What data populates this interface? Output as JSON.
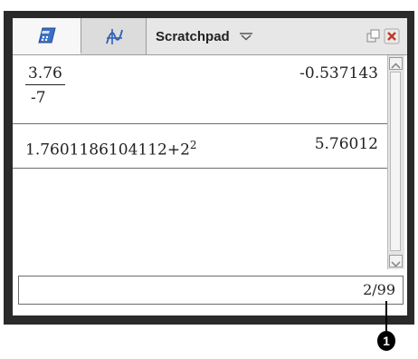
{
  "tabs": [
    {
      "icon": "calculator-icon",
      "selected": true
    },
    {
      "icon": "graph-icon",
      "selected": false
    },
    {
      "label": "Scratchpad",
      "icon": "chevron-down-icon"
    }
  ],
  "window_icons": [
    "restore-icon",
    "close-icon"
  ],
  "history": [
    {
      "expression": {
        "numerator": "3.76",
        "denominator": "-7"
      },
      "result": "-0.537143"
    },
    {
      "expression": {
        "base": "1.7601186104112+2",
        "exponent": "2"
      },
      "result": "5.76012"
    }
  ],
  "status": {
    "page_counter": "2/99"
  },
  "callout": {
    "label": "1"
  },
  "colors": {
    "close": "#c0392b",
    "tab_bar": "#e7e7e7",
    "bezel": "#2a2a2a"
  }
}
